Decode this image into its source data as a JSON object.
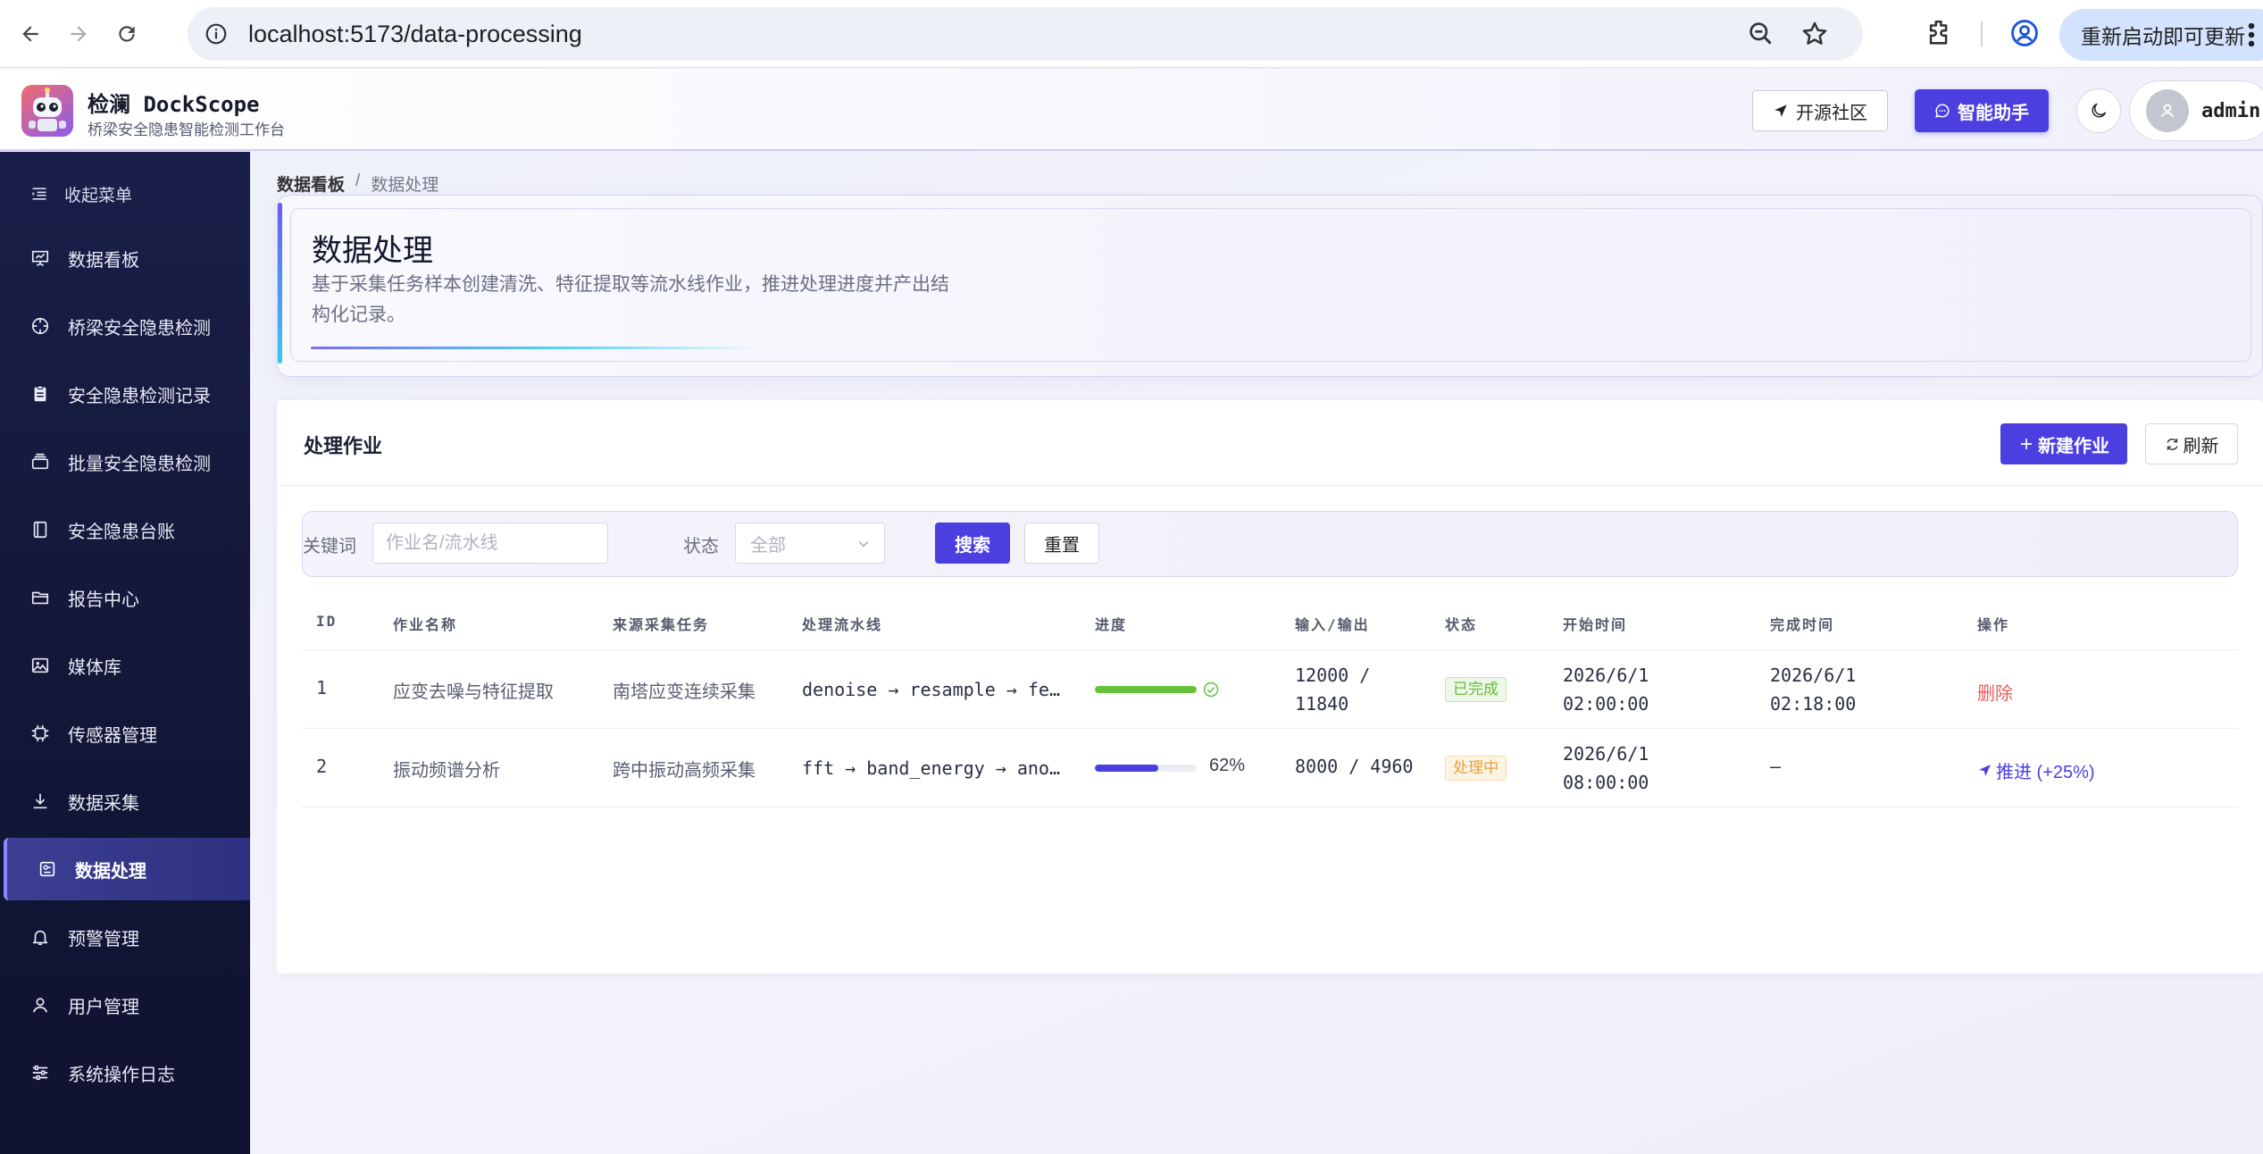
{
  "browser": {
    "url": "localhost:5173/data-processing",
    "update_label": "重新启动即可更新"
  },
  "header": {
    "brand_title": "检澜 DockScope",
    "brand_subtitle": "桥梁安全隐患智能检测工作台",
    "community_label": "开源社区",
    "assistant_label": "智能助手",
    "username": "admin"
  },
  "sidebar": {
    "collapse_label": "收起菜单",
    "items": [
      {
        "label": "数据看板",
        "icon": "chart-board-icon"
      },
      {
        "label": "桥梁安全隐患检测",
        "icon": "target-icon"
      },
      {
        "label": "安全隐患检测记录",
        "icon": "clipboard-icon"
      },
      {
        "label": "批量安全隐患检测",
        "icon": "stack-icon"
      },
      {
        "label": "安全隐患台账",
        "icon": "ledger-icon"
      },
      {
        "label": "报告中心",
        "icon": "folder-icon"
      },
      {
        "label": "媒体库",
        "icon": "image-icon"
      },
      {
        "label": "传感器管理",
        "icon": "chip-icon"
      },
      {
        "label": "数据采集",
        "icon": "download-icon"
      },
      {
        "label": "数据处理",
        "icon": "processing-icon",
        "active": true
      },
      {
        "label": "预警管理",
        "icon": "bell-icon"
      },
      {
        "label": "用户管理",
        "icon": "user-icon"
      },
      {
        "label": "系统操作日志",
        "icon": "sliders-icon"
      }
    ]
  },
  "breadcrumb": {
    "home": "数据看板",
    "separator": "/",
    "current": "数据处理"
  },
  "hero": {
    "title": "数据处理",
    "description": "基于采集任务样本创建清洗、特征提取等流水线作业，推进处理进度并产出结构化记录。"
  },
  "panel": {
    "title": "处理作业",
    "new_label": "新建作业",
    "refresh_label": "刷新"
  },
  "filter": {
    "keyword_label": "关键词",
    "keyword_placeholder": "作业名/流水线",
    "status_label": "状态",
    "status_value": "全部",
    "search_label": "搜索",
    "reset_label": "重置"
  },
  "table": {
    "columns": [
      "ID",
      "作业名称",
      "来源采集任务",
      "处理流水线",
      "进度",
      "输入/输出",
      "状态",
      "开始时间",
      "完成时间",
      "操作"
    ],
    "rows": [
      {
        "id": "1",
        "name": "应变去噪与特征提取",
        "source": "南塔应变连续采集",
        "pipeline": "denoise → resample → feature_extract",
        "progress": 100,
        "progress_text": "",
        "io_line1": "12000 /",
        "io_line2": "11840",
        "status": "已完成",
        "start_line1": "2026/6/1",
        "start_line2": "02:00:00",
        "end_line1": "2026/6/1",
        "end_line2": "02:18:00",
        "action": "删除"
      },
      {
        "id": "2",
        "name": "振动频谱分析",
        "source": "跨中振动高频采集",
        "pipeline": "fft → band_energy → anomaly_detect",
        "progress": 62,
        "progress_text": "62%",
        "io": "8000 / 4960",
        "status": "处理中",
        "start_line1": "2026/6/1",
        "start_line2": "08:00:00",
        "end": "—",
        "action": "推进 (+25%)"
      }
    ]
  },
  "colors": {
    "primary": "#4b3fe0",
    "success": "#67c23a",
    "warning": "#e6a23c",
    "danger": "#f05a5a",
    "sidebar_bg": "#141839"
  }
}
